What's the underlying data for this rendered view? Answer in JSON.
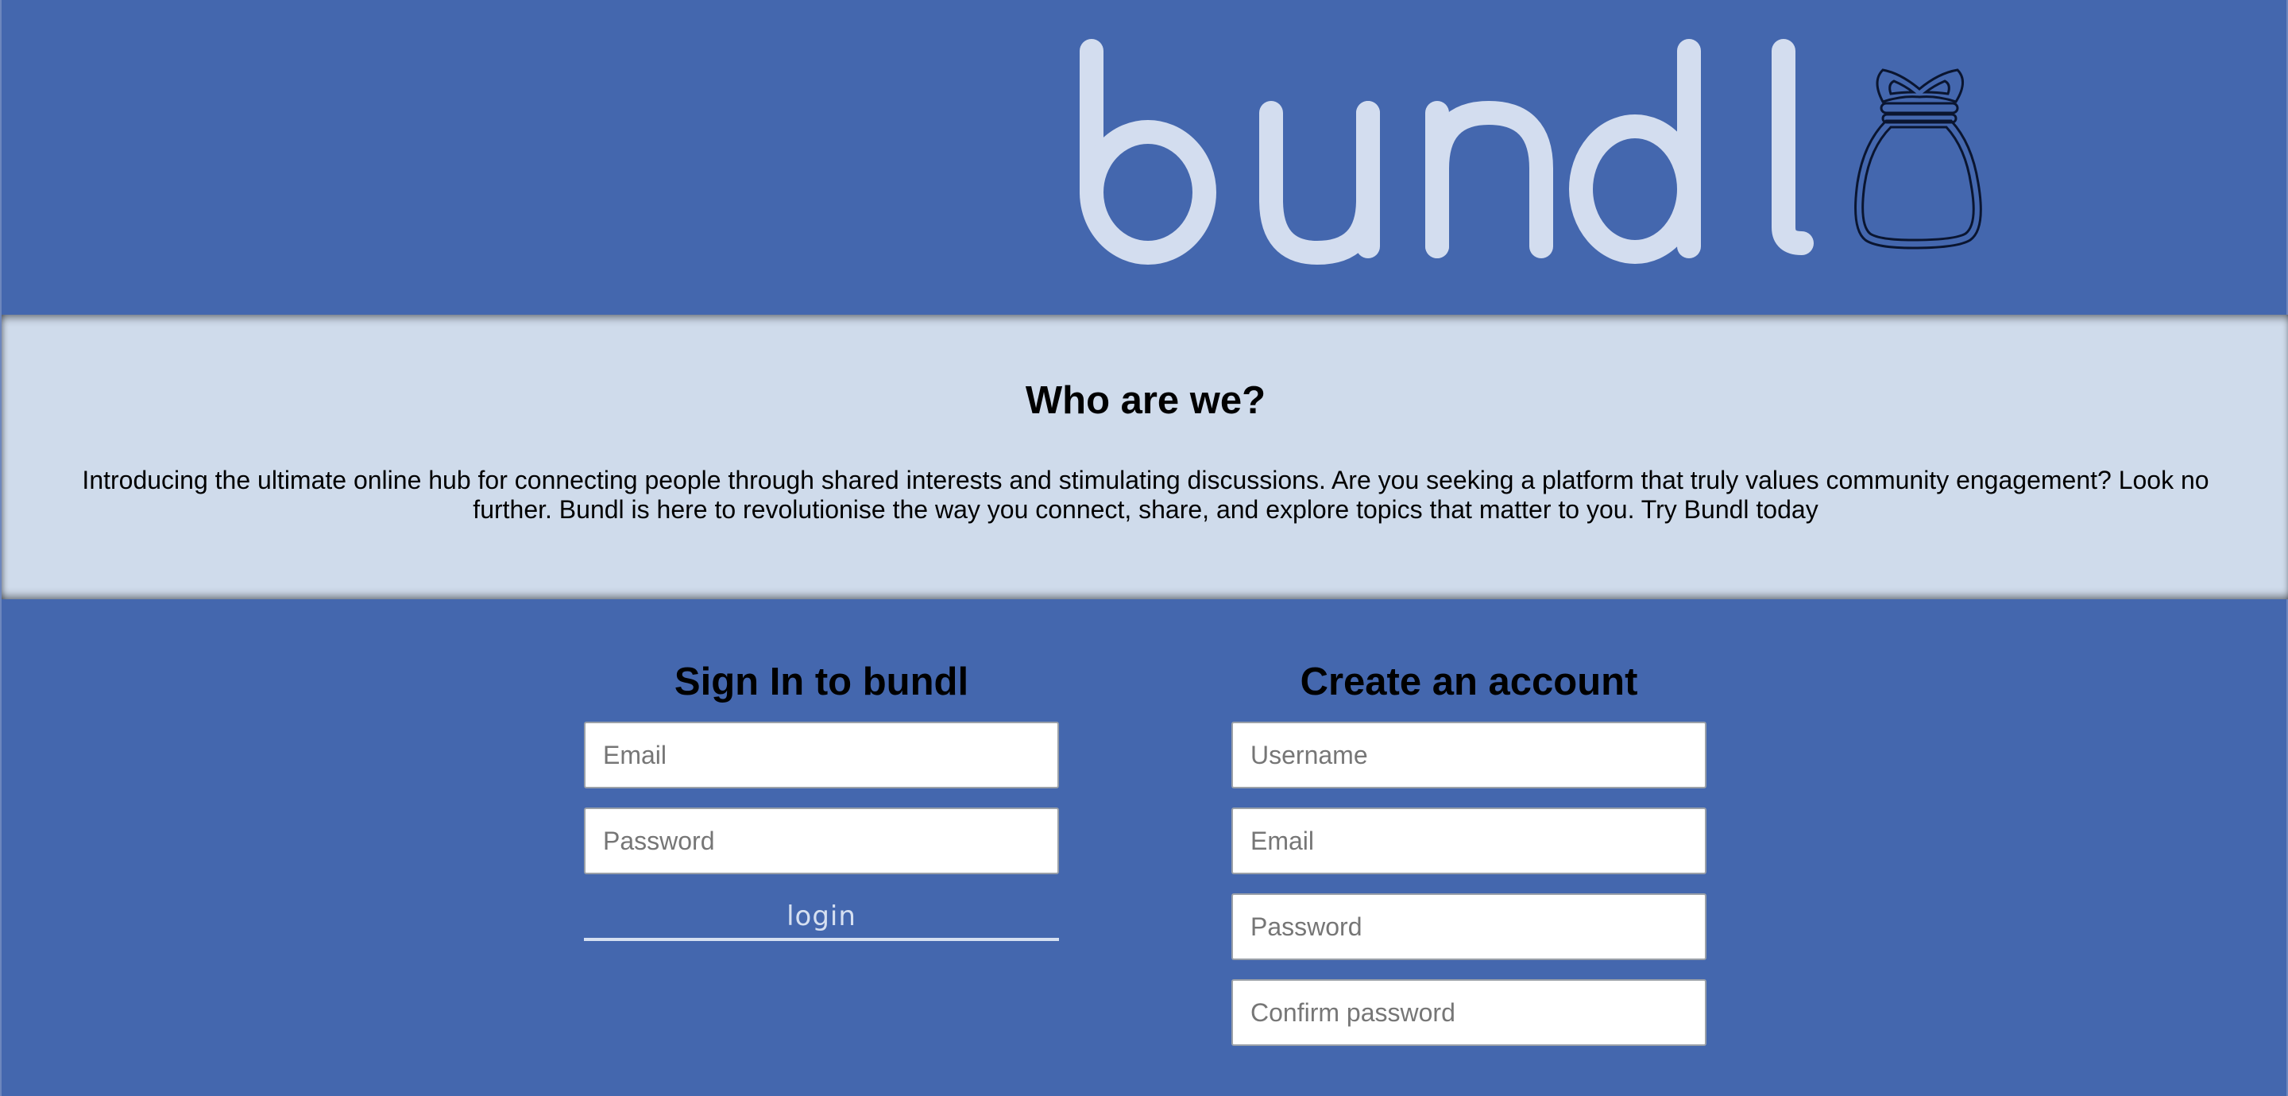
{
  "brand": {
    "wordmark": "bundl",
    "icon": "money-bag-icon",
    "wordmark_color": "#d3ddef",
    "bag_stroke_color": "#0a1530"
  },
  "colors": {
    "page_bg": "#4467ae",
    "about_bg": "#cfdbeb",
    "input_bg": "#ffffff",
    "login_text": "#d6e0f1"
  },
  "about": {
    "heading": "Who are we?",
    "body": "Introducing the ultimate online hub for connecting people through shared interests and stimulating discussions. Are you seeking a platform that truly values community engagement? Look no further. Bundl is here to revolutionise the way you connect, share, and explore topics that matter to you. Try Bundl today"
  },
  "signin": {
    "title": "Sign In to bundl",
    "email_placeholder": "Email",
    "password_placeholder": "Password",
    "login_label": "login"
  },
  "signup": {
    "title": "Create an account",
    "username_placeholder": "Username",
    "email_placeholder": "Email",
    "password_placeholder": "Password",
    "confirm_placeholder": "Confirm password"
  }
}
